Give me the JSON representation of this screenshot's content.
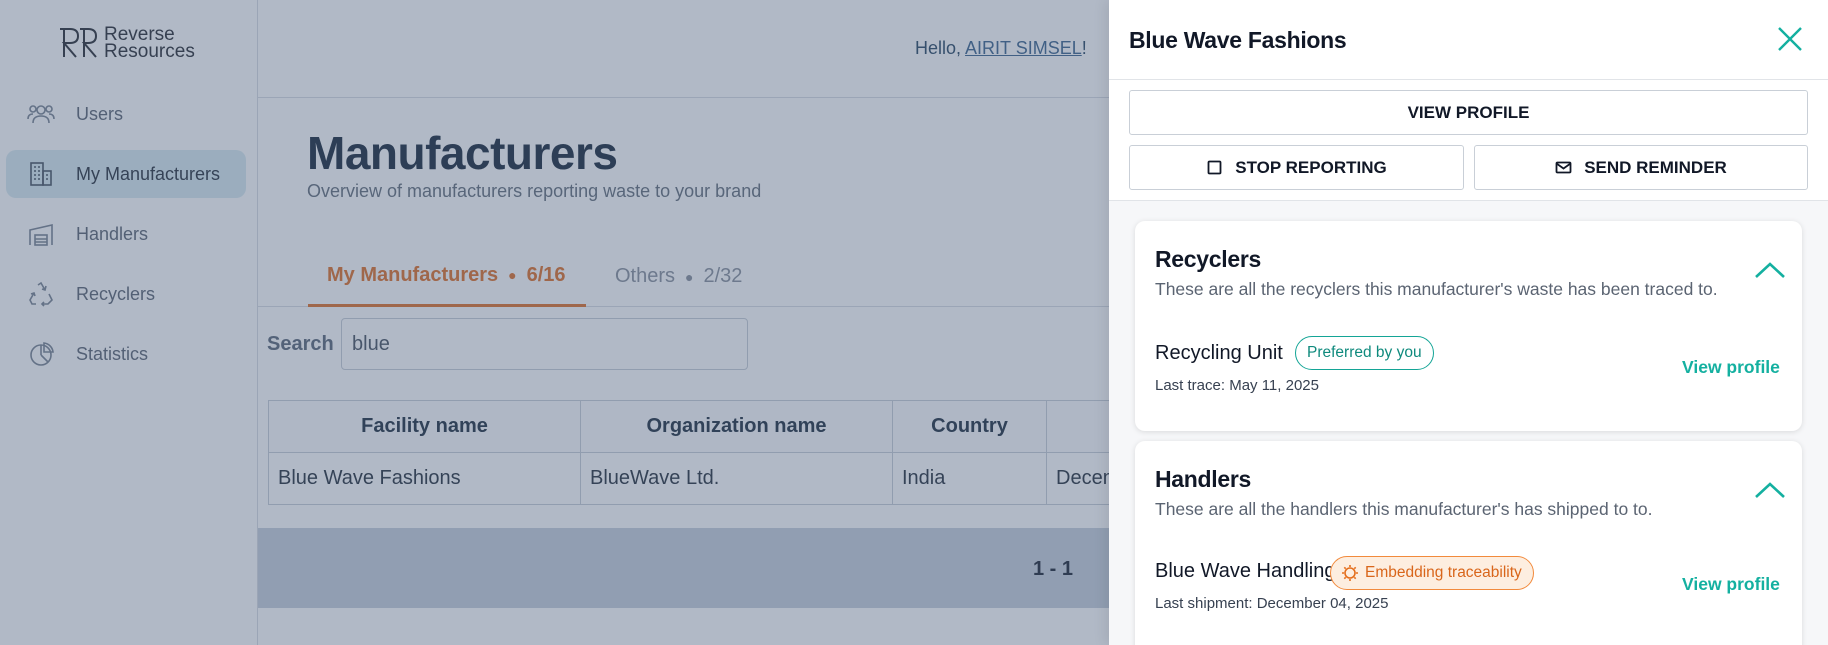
{
  "brand": {
    "name_line1": "Reverse",
    "name_line2": "Resources"
  },
  "sidebar": {
    "items": [
      {
        "label": "Users",
        "icon": "users-icon"
      },
      {
        "label": "My Manufacturers",
        "icon": "building-icon",
        "active": true
      },
      {
        "label": "Handlers",
        "icon": "warehouse-icon"
      },
      {
        "label": "Recyclers",
        "icon": "recycle-icon"
      },
      {
        "label": "Statistics",
        "icon": "pie-chart-icon"
      }
    ]
  },
  "header": {
    "greeting_prefix": "Hello, ",
    "user_name": "AIRIT SIMSEL",
    "greeting_suffix": "!"
  },
  "page": {
    "title": "Manufacturers",
    "subtitle": "Overview of manufacturers reporting waste to your brand"
  },
  "tabs": [
    {
      "label": "My Manufacturers",
      "count": "6/16",
      "active": true
    },
    {
      "label": "Others",
      "count": "2/32",
      "active": false
    }
  ],
  "search": {
    "label": "Search",
    "value": "blue"
  },
  "table": {
    "columns": [
      "Facility name",
      "Organization name",
      "Country",
      ""
    ],
    "rows": [
      [
        "Blue Wave Fashions",
        "BlueWave Ltd.",
        "India",
        "Decem"
      ]
    ]
  },
  "pagination": {
    "range": "1 - 1"
  },
  "drawer": {
    "title": "Blue Wave Fashions",
    "actions": {
      "view_profile": "VIEW PROFILE",
      "stop_reporting": "STOP REPORTING",
      "send_reminder": "SEND REMINDER"
    },
    "recyclers": {
      "title": "Recyclers",
      "subtitle": "These are all the recyclers this manufacturer's waste has been traced to.",
      "entry": {
        "name": "Recycling Unit",
        "badge": "Preferred by you",
        "meta": "Last trace: May 11, 2025",
        "link": "View profile"
      }
    },
    "handlers": {
      "title": "Handlers",
      "subtitle": "These are all the handlers this manufacturer's has shipped to to.",
      "entry": {
        "name": "Blue Wave Handling",
        "badge": "Embedding traceability",
        "meta": "Last shipment: December 04, 2025",
        "link": "View profile"
      }
    }
  },
  "colors": {
    "accent": "#14b0a0",
    "tab_active": "#e0722c",
    "badge_orange": "#f28a3c"
  }
}
